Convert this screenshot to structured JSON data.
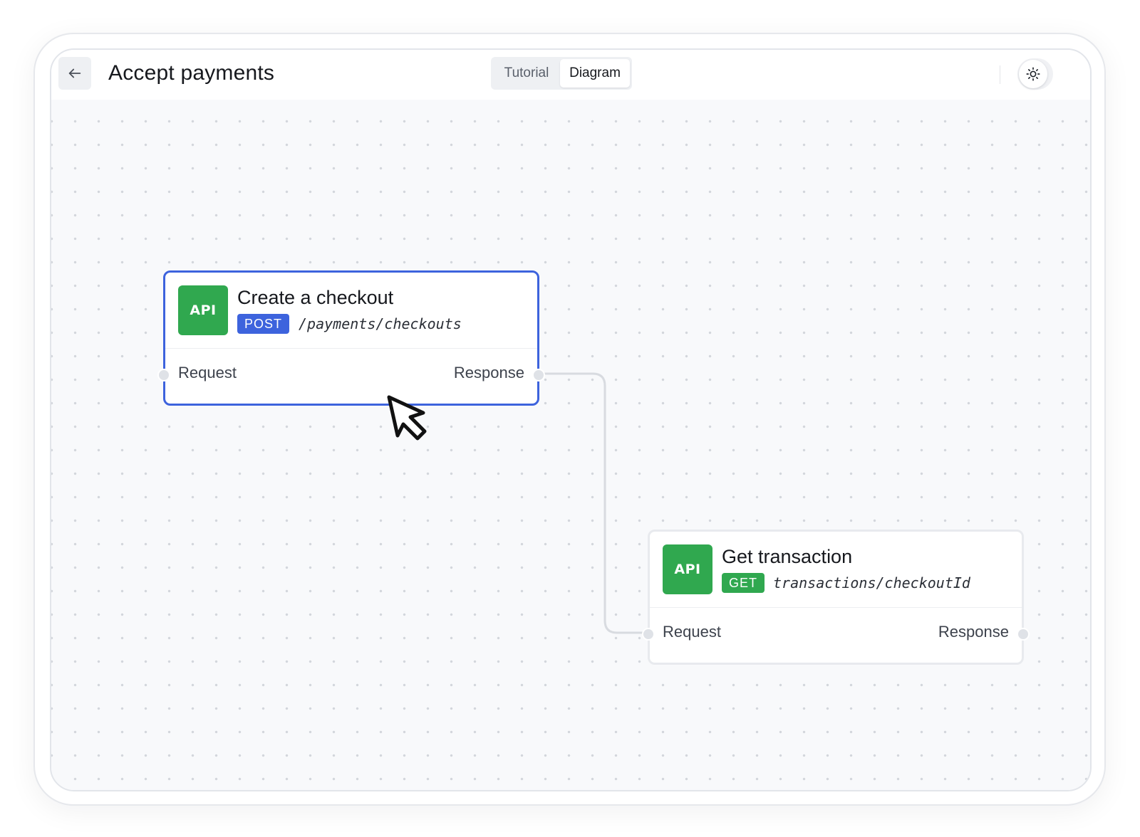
{
  "header": {
    "title": "Accept payments",
    "back_icon": "arrow-left-icon",
    "tabs": [
      {
        "label": "Tutorial",
        "active": false
      },
      {
        "label": "Diagram",
        "active": true
      }
    ],
    "theme_icon": "sun-icon"
  },
  "diagram": {
    "nodes": [
      {
        "badge": "API",
        "title": "Create a checkout",
        "method": "POST",
        "endpoint": "/payments/checkouts",
        "input_port": "Request",
        "output_port": "Response",
        "selected": true
      },
      {
        "badge": "API",
        "title": "Get transaction",
        "method": "GET",
        "endpoint": "transactions/checkoutId",
        "input_port": "Request",
        "output_port": "Response",
        "selected": false
      }
    ],
    "edges": [
      {
        "from": "Create a checkout.Response",
        "to": "Get transaction.Request"
      }
    ]
  },
  "colors": {
    "accent": "#3d63dd",
    "api_green": "#30a84f",
    "canvas": "#f8f9fb"
  }
}
